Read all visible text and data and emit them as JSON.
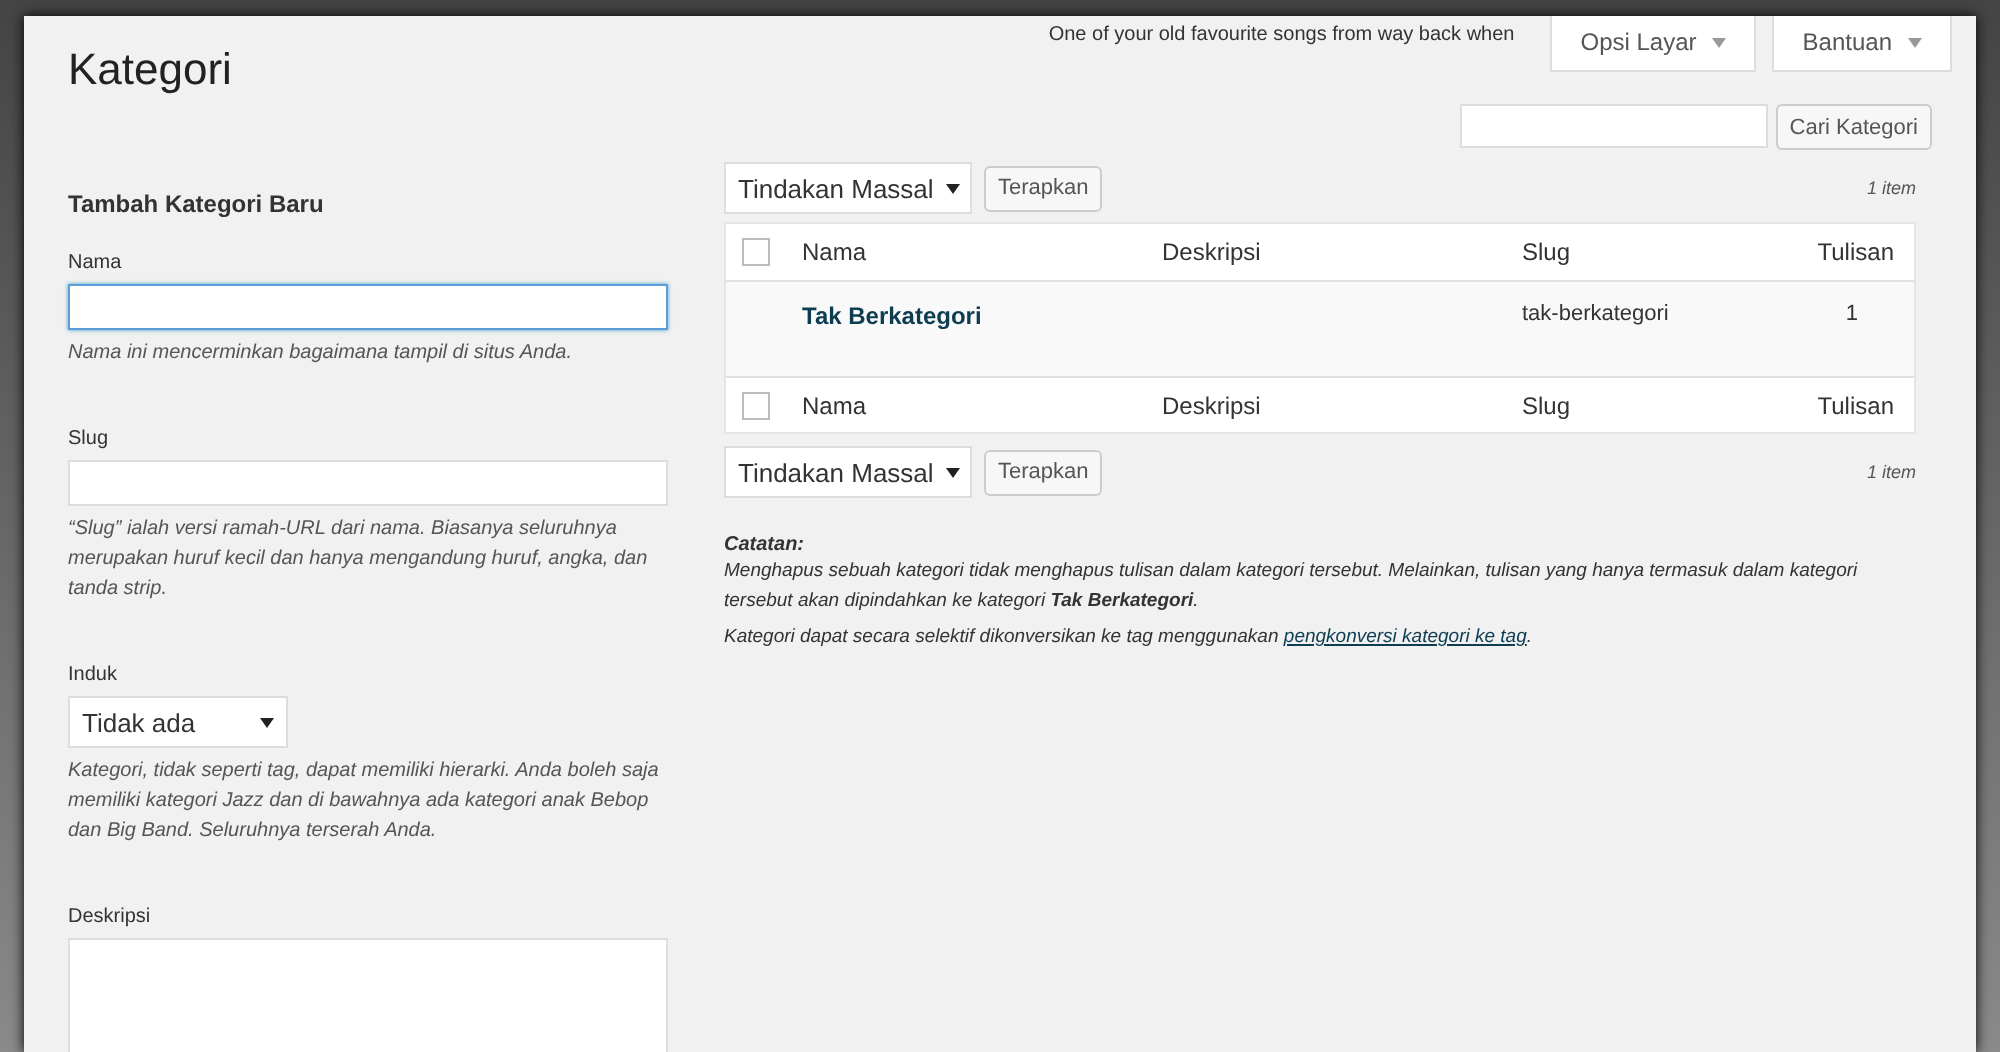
{
  "header": {
    "tagline": "One of your old favourite songs from way back when",
    "screen_options": "Opsi Layar",
    "help": "Bantuan",
    "title": "Kategori"
  },
  "search": {
    "button": "Cari Kategori"
  },
  "form": {
    "heading": "Tambah Kategori Baru",
    "name_label": "Nama",
    "name_focused": true,
    "name_hint": "Nama ini mencerminkan bagaimana tampil di situs Anda.",
    "slug_label": "Slug",
    "slug_hint": "“Slug” ialah versi ramah-URL dari nama. Biasanya seluruhnya merupakan huruf kecil dan hanya mengandung huruf, angka, dan tanda strip.",
    "parent_label": "Induk",
    "parent_value": "Tidak ada",
    "parent_hint": "Kategori, tidak seperti tag, dapat memiliki hierarki. Anda boleh saja memiliki kategori Jazz dan di bawahnya ada kategori anak Bebop dan Big Band. Seluruhnya terserah Anda.",
    "description_label": "Deskripsi"
  },
  "bulk_top": {
    "action": "Tindakan Massal",
    "apply": "Terapkan",
    "count": "1 item"
  },
  "table": {
    "columns": [
      "Nama",
      "Deskripsi",
      "Slug",
      "Tulisan"
    ],
    "footer_columns": [
      "Nama",
      "Deskripsi",
      "Slug",
      "Tulisan"
    ],
    "header_checked": false,
    "footer_checked": false,
    "rows": [
      {
        "name": "Tak Berkategori",
        "slug": "tak-berkategori",
        "count": "1"
      }
    ]
  },
  "bulk_bottom": {
    "action": "Tindakan Massal",
    "apply": "Terapkan",
    "count": "1 item"
  },
  "note": {
    "title": "Catatan:",
    "text": "Menghapus sebuah kategori tidak menghapus tulisan dalam kategori tersebut. Melainkan, tulisan yang hanya termasuk dalam kategori tersebut akan dipindahkan ke kategori **Tak Berkategori**.",
    "convert_before": "Kategori dapat secara selektif dikonversikan ke tag menggunakan ",
    "convert_link": "pengkonversi kategori ke tag",
    "convert_after": "."
  }
}
